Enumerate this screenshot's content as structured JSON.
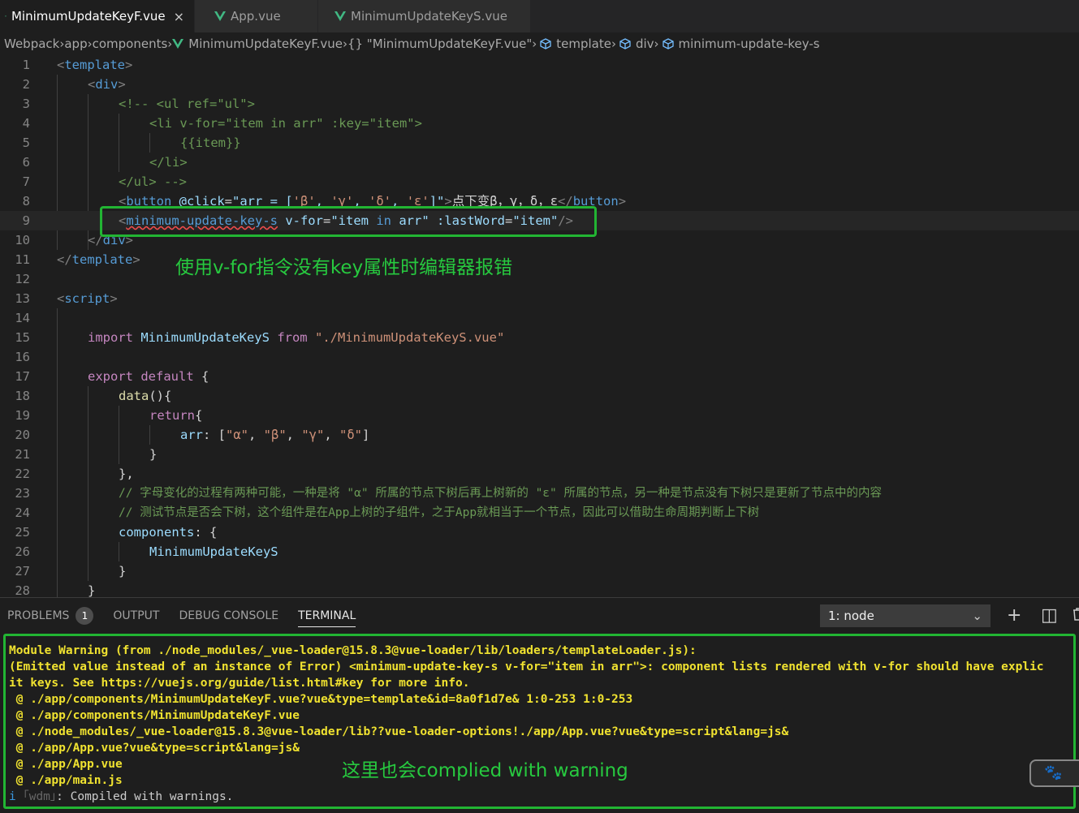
{
  "tabs": [
    {
      "label": "MinimumUpdateKeyF.vue",
      "active": true,
      "close": "×"
    },
    {
      "label": "App.vue",
      "active": false
    },
    {
      "label": "MinimumUpdateKeyS.vue",
      "active": false
    }
  ],
  "breadcrumb": {
    "items": [
      "Webpack",
      "app",
      "components",
      "MinimumUpdateKeyF.vue",
      "{} \"MinimumUpdateKeyF.vue\"",
      "template",
      "div",
      "minimum-update-key-s"
    ],
    "sep": "›"
  },
  "editor": {
    "line_numbers": [
      "1",
      "2",
      "3",
      "4",
      "5",
      "6",
      "7",
      "8",
      "9",
      "10",
      "11",
      "12",
      "13",
      "14",
      "15",
      "16",
      "17",
      "18",
      "19",
      "20",
      "21",
      "22",
      "23",
      "24",
      "25",
      "26",
      "27",
      "28"
    ],
    "code": {
      "l1": {
        "a": "<",
        "b": "template",
        "c": ">"
      },
      "l2": {
        "a": "<",
        "b": "div",
        "c": ">"
      },
      "l3": "<!-- <ul ref=\"ul\">",
      "l4": "<li v-for=\"item in arr\" :key=\"item\">",
      "l5": "{{item}}",
      "l6": "</li>",
      "l7": "</ul> -->",
      "l8": {
        "open": "<",
        "tag": "button",
        "attr": " @click",
        "eq": "=",
        "v1": "\"arr = [",
        "s1": "'β'",
        "c1": ", ",
        "s2": "'γ'",
        "c2": ", ",
        "s3": "'δ'",
        "c3": ", ",
        "s4": "'ε'",
        "v2": "]\"",
        "close": ">",
        "text": "点下变β，γ，δ，ε",
        "endopen": "</",
        "endtag": "button",
        "endclose": ">"
      },
      "l9": {
        "open": "<",
        "tag": "minimum-update-key-s",
        "attr1": " v-for",
        "eq1": "=",
        "val1a": "\"item ",
        "kw": "in",
        "val1b": " arr\"",
        "attr2": " :lastWord",
        "eq2": "=",
        "val2": "\"item\"",
        "close": "/>"
      },
      "l10": {
        "a": "</",
        "b": "div",
        "c": ">"
      },
      "l11": {
        "a": "</",
        "b": "template",
        "c": ">"
      },
      "l13": {
        "a": "<",
        "b": "script",
        "c": ">"
      },
      "l15": {
        "kw1": "import",
        "cls": " MinimumUpdateKeyS",
        "kw2": " from",
        "str": " \"./MinimumUpdateKeyS.vue\""
      },
      "l17": {
        "kw": "export",
        "kw2": " default",
        "p": " {"
      },
      "l18": {
        "fn": "data",
        "p": "(){"
      },
      "l19": {
        "kw": "return",
        "p": "{"
      },
      "l20": {
        "attr": "arr",
        "p": ": [",
        "s1": "\"α\"",
        "c1": ", ",
        "s2": "\"β\"",
        "c2": ", ",
        "s3": "\"γ\"",
        "c3": ", ",
        "s4": "\"δ\"",
        "e": "]"
      },
      "l21": "}",
      "l22": "},",
      "l23": "// 字母变化的过程有两种可能，一种是将 \"α\" 所属的节点下树后再上树新的 \"ε\" 所属的节点，另一种是节点没有下树只是更新了节点中的内容",
      "l24": "// 测试节点是否会下树，这个组件是在App上树的子组件，之于App就相当于一个节点，因此可以借助生命周期判断上下树",
      "l25": {
        "attr": "components",
        "p": ": {"
      },
      "l26": "MinimumUpdateKeyS",
      "l27": "}",
      "l28": "}"
    },
    "annotation": "使用v-for指令没有key属性时编辑器报错"
  },
  "panel": {
    "tabs": [
      {
        "label": "PROBLEMS",
        "badge": "1"
      },
      {
        "label": "OUTPUT"
      },
      {
        "label": "DEBUG CONSOLE"
      },
      {
        "label": "TERMINAL",
        "active": true
      }
    ],
    "terminal_select": "1: node",
    "select_chevron": "⌄",
    "add_icon": "+",
    "split_icon": "◫",
    "terminal_lines": [
      "Module Warning (from ./node_modules/_vue-loader@15.8.3@vue-loader/lib/loaders/templateLoader.js):",
      "(Emitted value instead of an instance of Error) <minimum-update-key-s v-for=\"item in arr\">: component lists rendered with v-for should have explic",
      "it keys. See https://vuejs.org/guide/list.html#key for more info.",
      " @ ./app/components/MinimumUpdateKeyF.vue?vue&type=template&id=8a0f1d7e& 1:0-253 1:0-253",
      " @ ./app/components/MinimumUpdateKeyF.vue",
      " @ ./node_modules/_vue-loader@15.8.3@vue-loader/lib??vue-loader-options!./app/App.vue?vue&type=script&lang=js&",
      " @ ./app/App.vue?vue&type=script&lang=js&",
      " @ ./app/App.vue",
      " @ ./app/main.js"
    ],
    "status": {
      "i": "i",
      "wdm": " ｢wdm｣",
      "text": ": Compiled with warnings."
    },
    "annotation": "这里也会complied with warning",
    "float_icon": "🐾"
  }
}
